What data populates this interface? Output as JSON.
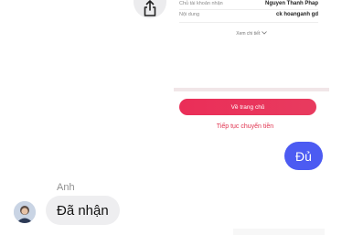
{
  "receipt": {
    "rows": [
      {
        "label": "Chủ tài khoản nhận",
        "value": "Nguyen Thanh Phap"
      },
      {
        "label": "Nội dung",
        "value": "ck hoanganh gd"
      }
    ],
    "details_link": "Xem chi tiết",
    "home_button": "Về trang chủ",
    "continue_link": "Tiếp tục chuyển tiền"
  },
  "chat": {
    "sent_message": "Đủ",
    "sender_name": "Anh",
    "received_message": "Đã nhận"
  },
  "icons": {
    "share": "share-icon",
    "chevron": "chevron-down-icon",
    "avatar": "avatar"
  }
}
